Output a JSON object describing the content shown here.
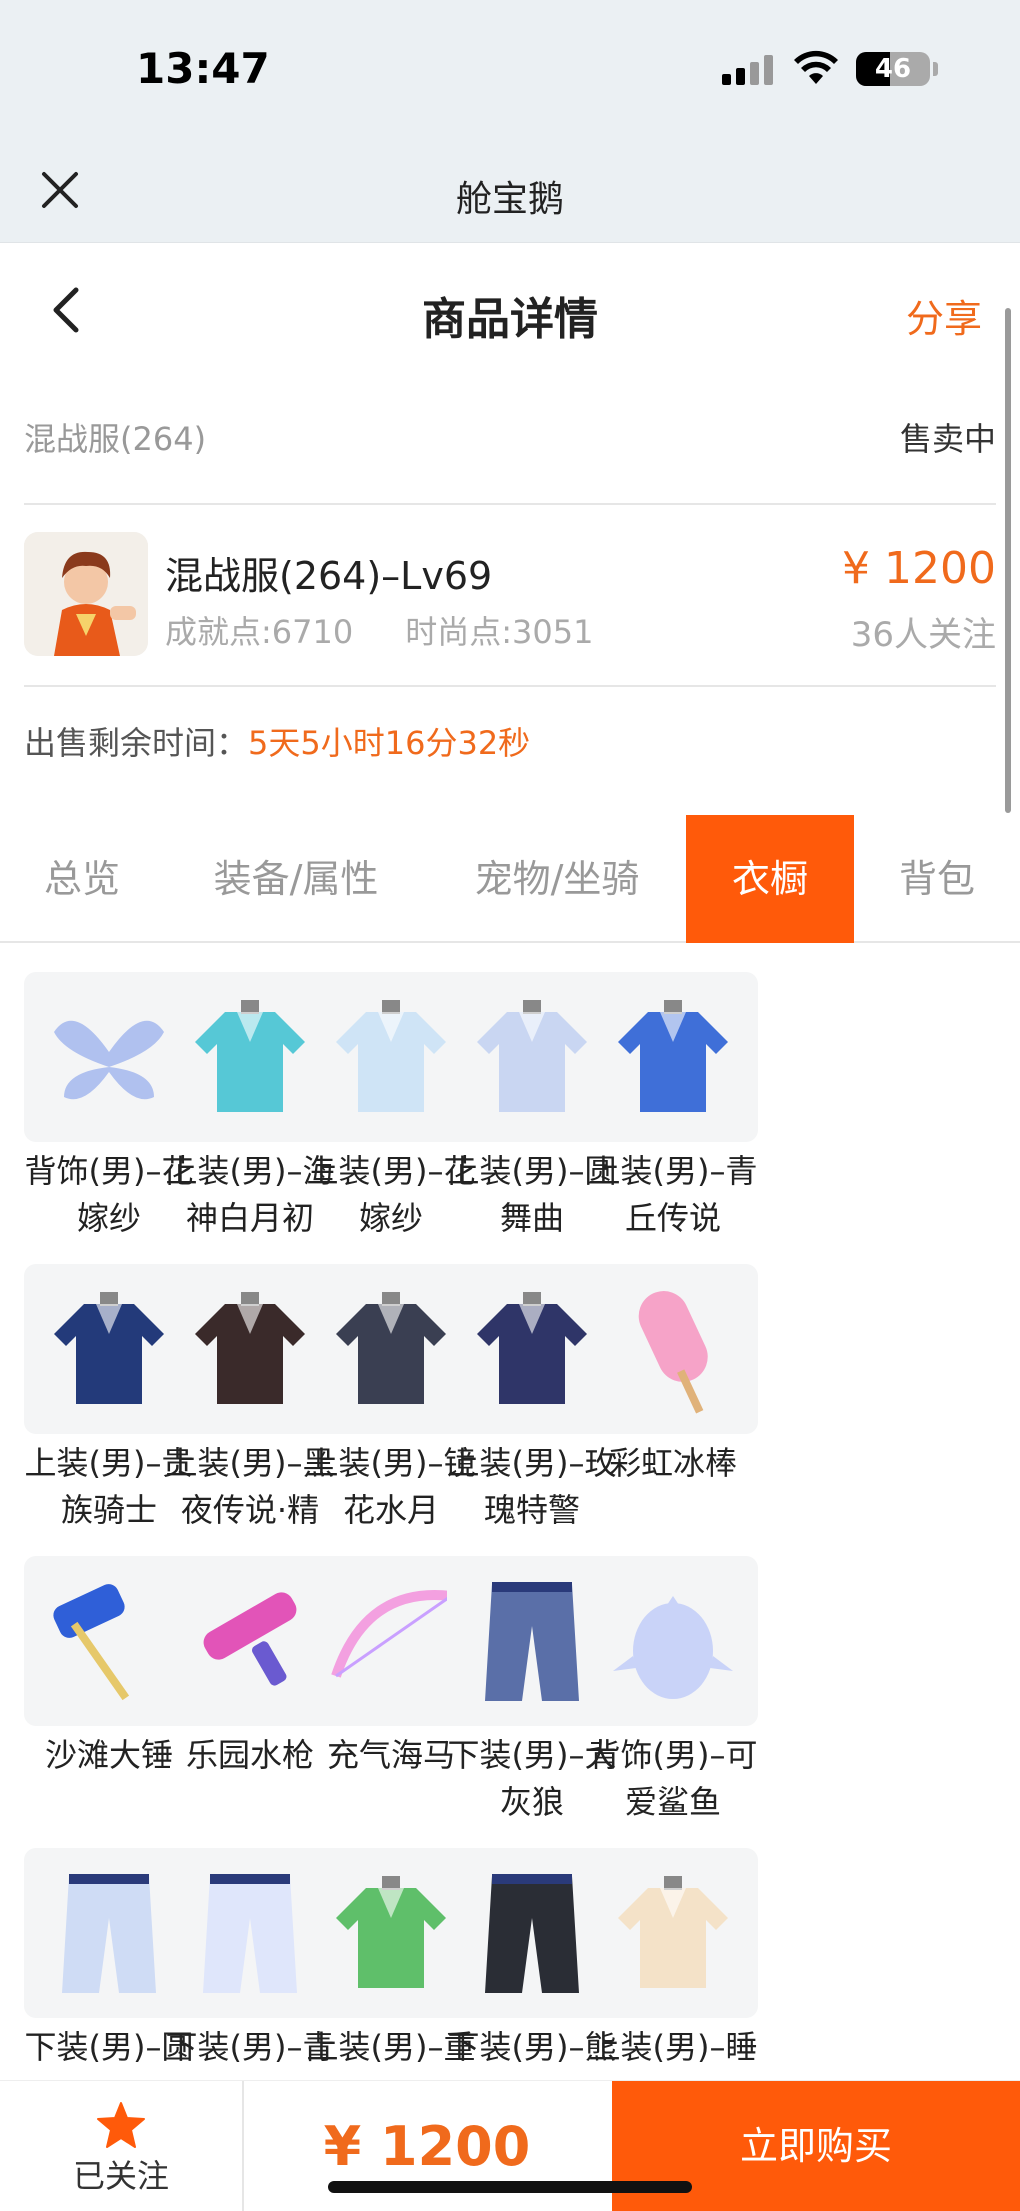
{
  "status_bar": {
    "time": "13:47",
    "battery": "46",
    "battery_level": 0.46
  },
  "app_bar": {
    "title": "舱宝鹅"
  },
  "nav": {
    "title": "商品详情",
    "share": "分享"
  },
  "listing": {
    "server": "混战服(264)",
    "status": "售卖中",
    "name": "混战服(264)–Lv69",
    "achievement": "成就点:6710",
    "fashion": "时尚点:3051",
    "price": "¥ 1200",
    "followers": "36人关注",
    "remaining_label": "出售剩余时间：",
    "remaining_value": "5天5小时16分32秒"
  },
  "tabs": [
    {
      "label": "总览"
    },
    {
      "label": "装备/属性"
    },
    {
      "label": "宠物/坐骑"
    },
    {
      "label": "衣橱",
      "active": true
    },
    {
      "label": "背包"
    }
  ],
  "items": [
    {
      "name": "背饰(男)–花嫁纱",
      "icon": "wings-icon",
      "color": "#9fb4ee"
    },
    {
      "name": "上装(男)–海神白月初",
      "icon": "costume-icon",
      "color": "#56c8d6"
    },
    {
      "name": "上装(男)–花嫁纱",
      "icon": "costume-icon",
      "color": "#cfe4f6"
    },
    {
      "name": "上装(男)–圆舞曲",
      "icon": "costume-icon",
      "color": "#c9d6f2"
    },
    {
      "name": "上装(男)–青丘传说",
      "icon": "costume-icon",
      "color": "#3f6fd8"
    },
    {
      "name": "上装(男)–贵族骑士",
      "icon": "costume-icon",
      "color": "#233a7a"
    },
    {
      "name": "上装(男)–黑夜传说·精",
      "icon": "costume-icon",
      "color": "#3a2a2a"
    },
    {
      "name": "上装(男)–镜花水月",
      "icon": "costume-icon",
      "color": "#3a3f52"
    },
    {
      "name": "上装(男)–玫瑰特警",
      "icon": "costume-icon",
      "color": "#2f3568"
    },
    {
      "name": "彩虹冰棒",
      "icon": "popsicle-icon",
      "color": "#f6a3c8"
    },
    {
      "name": "沙滩大锤",
      "icon": "hammer-icon",
      "color": "#2f5fd8"
    },
    {
      "name": "乐园水枪",
      "icon": "water-gun-icon",
      "color": "#e254b8"
    },
    {
      "name": "充气海马",
      "icon": "bow-icon",
      "color": "#f3a0e0"
    },
    {
      "name": "下装(男)–大灰狼",
      "icon": "pants-icon",
      "color": "#5a6fa8"
    },
    {
      "name": "背饰(男)–可爱鲨鱼",
      "icon": "shark-icon",
      "color": "#c9d3f8"
    },
    {
      "name": "下装(男)–圆",
      "icon": "pants-icon",
      "color": "#cfdcf5"
    },
    {
      "name": "下装(男)–青",
      "icon": "pants-icon",
      "color": "#dfe6fb"
    },
    {
      "name": "上装(男)–重",
      "icon": "costume-icon",
      "color": "#5fbf6a"
    },
    {
      "name": "下装(男)–熊",
      "icon": "pants-icon",
      "color": "#2a2d35"
    },
    {
      "name": "上装(男)–睡",
      "icon": "costume-icon",
      "color": "#f4e2c8"
    }
  ],
  "bottom": {
    "follow_label": "已关注",
    "price": "¥ 1200",
    "buy_label": "立即购买"
  },
  "colors": {
    "accent": "#ff5a0a",
    "accent_text": "#f06a1c"
  }
}
